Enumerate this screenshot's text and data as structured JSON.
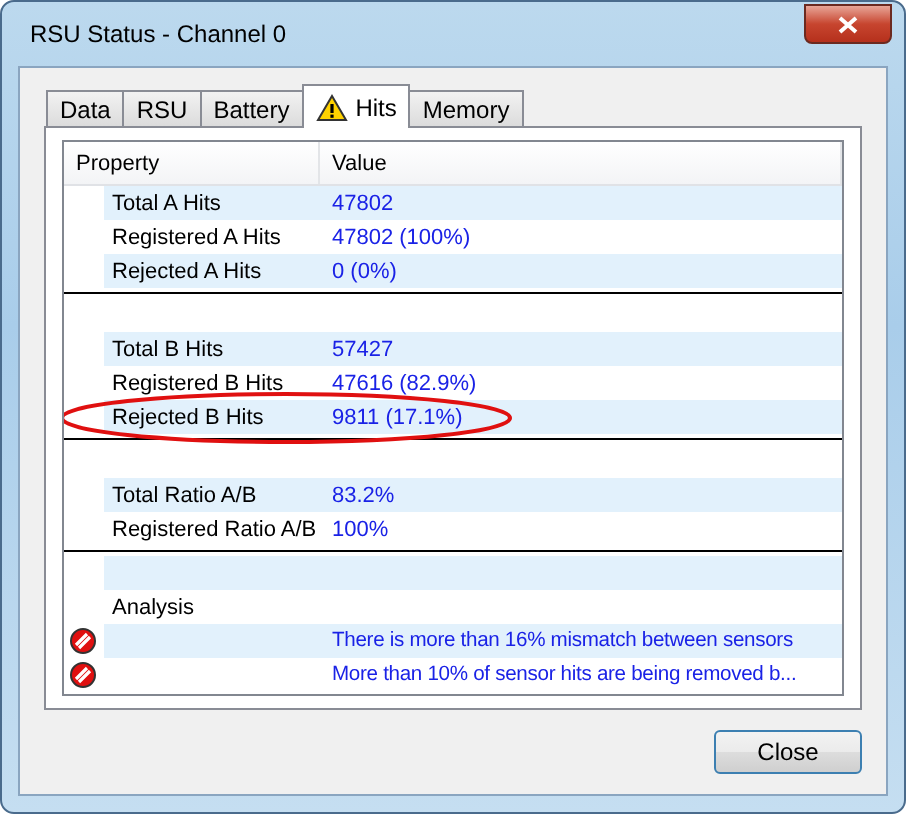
{
  "window": {
    "title": "RSU Status - Channel 0"
  },
  "tabs": [
    {
      "label": "Data",
      "selected": false,
      "warning": false
    },
    {
      "label": "RSU",
      "selected": false,
      "warning": false
    },
    {
      "label": "Battery",
      "selected": false,
      "warning": false
    },
    {
      "label": "Hits",
      "selected": true,
      "warning": true
    },
    {
      "label": "Memory",
      "selected": false,
      "warning": false
    }
  ],
  "table": {
    "columns": [
      "Property",
      "Value"
    ],
    "rows": [
      {
        "kind": "row",
        "property": "Total A Hits",
        "value": "47802",
        "shaded": true
      },
      {
        "kind": "row",
        "property": "Registered A Hits",
        "value": "47802 (100%)",
        "shaded": false
      },
      {
        "kind": "row",
        "property": "Rejected A Hits",
        "value": "0 (0%)",
        "shaded": true
      },
      {
        "kind": "separator"
      },
      {
        "kind": "blank",
        "shaded": false
      },
      {
        "kind": "row",
        "property": "Total B Hits",
        "value": "57427",
        "shaded": true
      },
      {
        "kind": "row",
        "property": "Registered B Hits",
        "value": "47616 (82.9%)",
        "shaded": false
      },
      {
        "kind": "row",
        "property": "Rejected B Hits",
        "value": "9811 (17.1%)",
        "shaded": true,
        "circled": true
      },
      {
        "kind": "separator"
      },
      {
        "kind": "blank",
        "shaded": false
      },
      {
        "kind": "row",
        "property": "Total Ratio A/B",
        "value": "83.2%",
        "shaded": true
      },
      {
        "kind": "row",
        "property": "Registered Ratio A/B",
        "value": "100%",
        "shaded": false
      },
      {
        "kind": "separator"
      },
      {
        "kind": "blank",
        "shaded": true
      },
      {
        "kind": "row",
        "property": "Analysis",
        "value": "",
        "shaded": false
      },
      {
        "kind": "alert",
        "value": "There is more than 16% mismatch between sensors",
        "shaded": true
      },
      {
        "kind": "alert",
        "value": "More than 10% of sensor hits are being removed b...",
        "shaded": false
      }
    ]
  },
  "buttons": [
    {
      "label": "Close"
    }
  ]
}
